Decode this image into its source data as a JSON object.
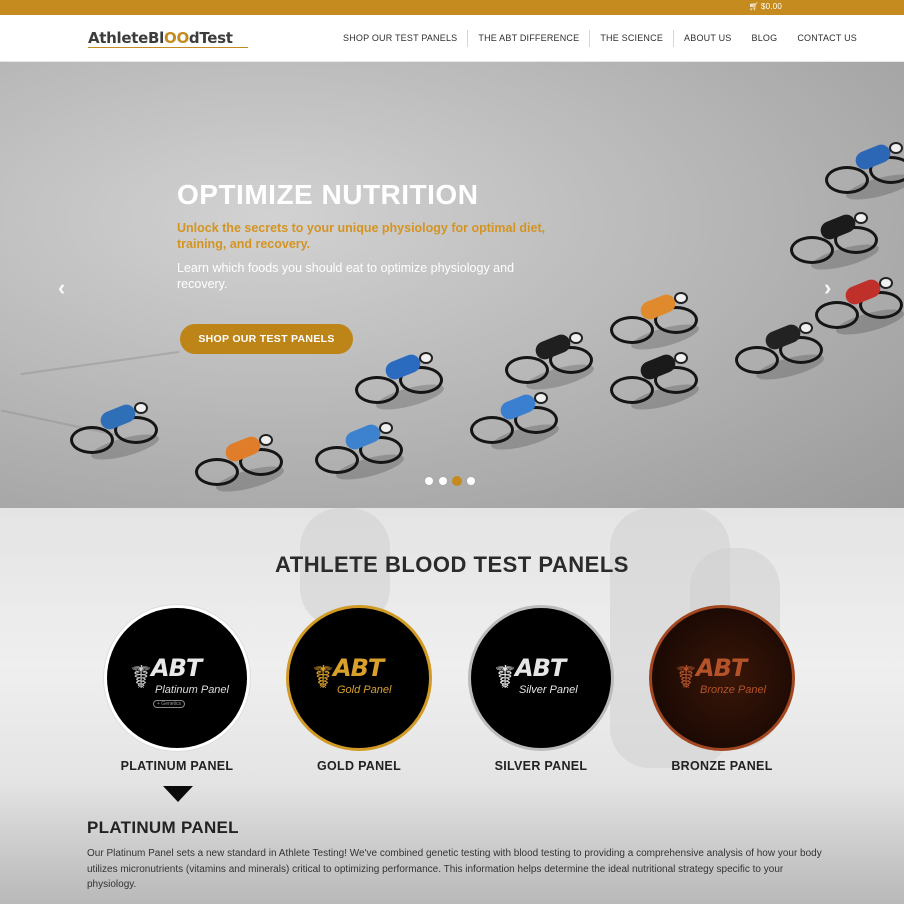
{
  "topbar": {
    "cart_icon": "cart-icon",
    "cart_total": "$0.00"
  },
  "header": {
    "logo": {
      "part1": "AthleteBl",
      "part2": "OO",
      "part3": "dTest"
    },
    "nav": [
      "SHOP OUR TEST PANELS",
      "THE ABT DIFFERENCE",
      "THE SCIENCE",
      "ABOUT US",
      "BLOG",
      "CONTACT US"
    ]
  },
  "hero": {
    "title": "OPTIMIZE NUTRITION",
    "subtitle": "Unlock the secrets to your unique physiology for optimal diet, training, and recovery.",
    "body": "Learn which foods you should eat to optimize physiology and recovery.",
    "cta": "SHOP OUR TEST PANELS",
    "prev_icon": "chevron-left-icon",
    "next_icon": "chevron-right-icon",
    "slides": 4,
    "active_slide": 3
  },
  "panels": {
    "title": "ATHLETE BLOOD TEST PANELS",
    "items": [
      {
        "label": "PLATINUM PANEL",
        "badge_abt": "ABT",
        "badge_name": "Platinum Panel",
        "badge_tag": "+ Genetics"
      },
      {
        "label": "GOLD PANEL",
        "badge_abt": "ABT",
        "badge_name": "Gold Panel"
      },
      {
        "label": "SILVER PANEL",
        "badge_abt": "ABT",
        "badge_name": "Silver Panel"
      },
      {
        "label": "BRONZE PANEL",
        "badge_abt": "ABT",
        "badge_name": "Bronze Panel"
      }
    ],
    "selected": {
      "title": "PLATINUM PANEL",
      "text": "Our Platinum Panel sets a new standard in Athlete Testing! We've combined genetic testing with blood testing to providing a comprehensive analysis of how your body utilizes micronutrients (vitamins and minerals) critical to optimizing performance. This information helps determine the ideal nutritional strategy specific to your physiology."
    }
  },
  "colors": {
    "brand_gold": "#c58b1e",
    "dark": "#222222"
  }
}
